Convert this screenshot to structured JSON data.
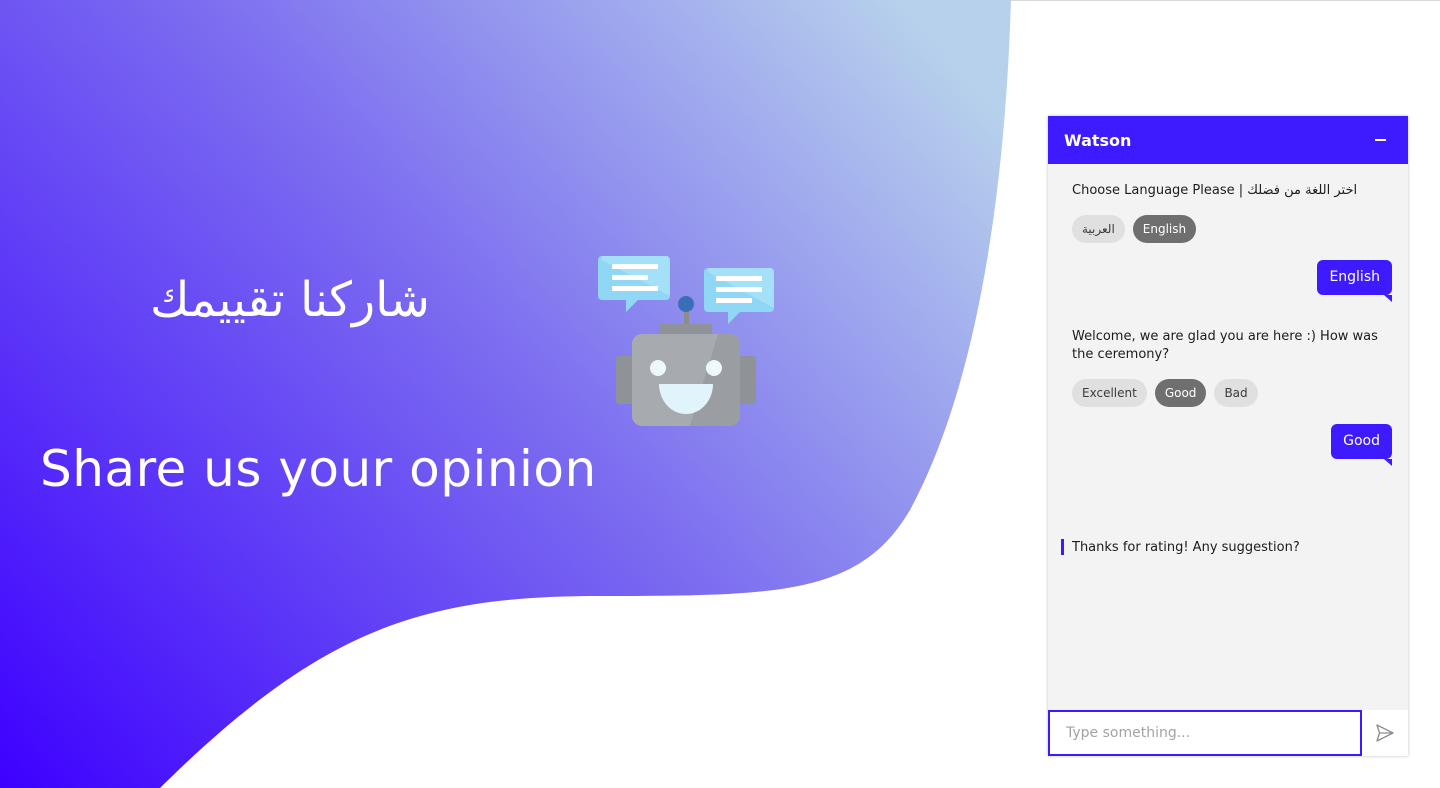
{
  "hero": {
    "title_ar": "شاركنا تقييمك",
    "title_en": "Share us your opinion",
    "gradient": {
      "start": "#3d00ff",
      "end": "#b7d1ec"
    },
    "robot_icon": "chatbot-robot-icon"
  },
  "chat": {
    "title": "Watson",
    "minimize_icon": "minimize-icon",
    "accent": "#3d1aff",
    "messages": {
      "prompt_language": "Choose Language Please | اختر اللغة من فضلك",
      "language_options": [
        "العربية",
        "English"
      ],
      "selected_language": "English",
      "user_reply_language": "English",
      "prompt_rating": "Welcome, we are glad you are here :) How was the ceremony?",
      "rating_options": [
        "Excellent",
        "Good",
        "Bad"
      ],
      "selected_rating": "Good",
      "user_reply_rating": "Good",
      "bot_thanks": "Thanks for rating! Any suggestion?"
    },
    "input": {
      "placeholder": "Type something...",
      "value": ""
    },
    "send_icon": "send-icon"
  }
}
